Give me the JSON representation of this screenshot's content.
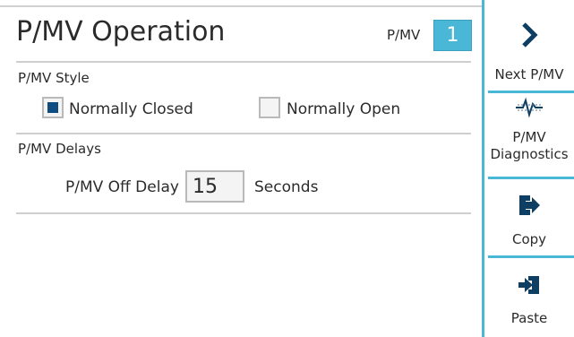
{
  "header": {
    "title": "P/MV Operation",
    "pmv_label": "P/MV",
    "pmv_number": "1"
  },
  "style_section": {
    "label": "P/MV Style",
    "options": [
      {
        "label": "Normally Closed",
        "checked": true
      },
      {
        "label": "Normally Open",
        "checked": false
      }
    ]
  },
  "delays_section": {
    "label": "P/MV Delays",
    "off_delay_label": "P/MV Off Delay",
    "off_delay_value": "15",
    "unit": "Seconds"
  },
  "sidebar": {
    "next": {
      "label": "Next P/MV",
      "icon": "chevron-right-icon"
    },
    "diagnostics": {
      "label_line1": "P/MV",
      "label_line2": "Diagnostics",
      "icon": "pulse-icon"
    },
    "copy": {
      "label": "Copy",
      "icon": "copy-arrow-icon"
    },
    "paste": {
      "label": "Paste",
      "icon": "paste-arrow-icon"
    }
  },
  "colors": {
    "accent": "#4bb7d6",
    "checkbox_fill": "#0f4c81"
  }
}
